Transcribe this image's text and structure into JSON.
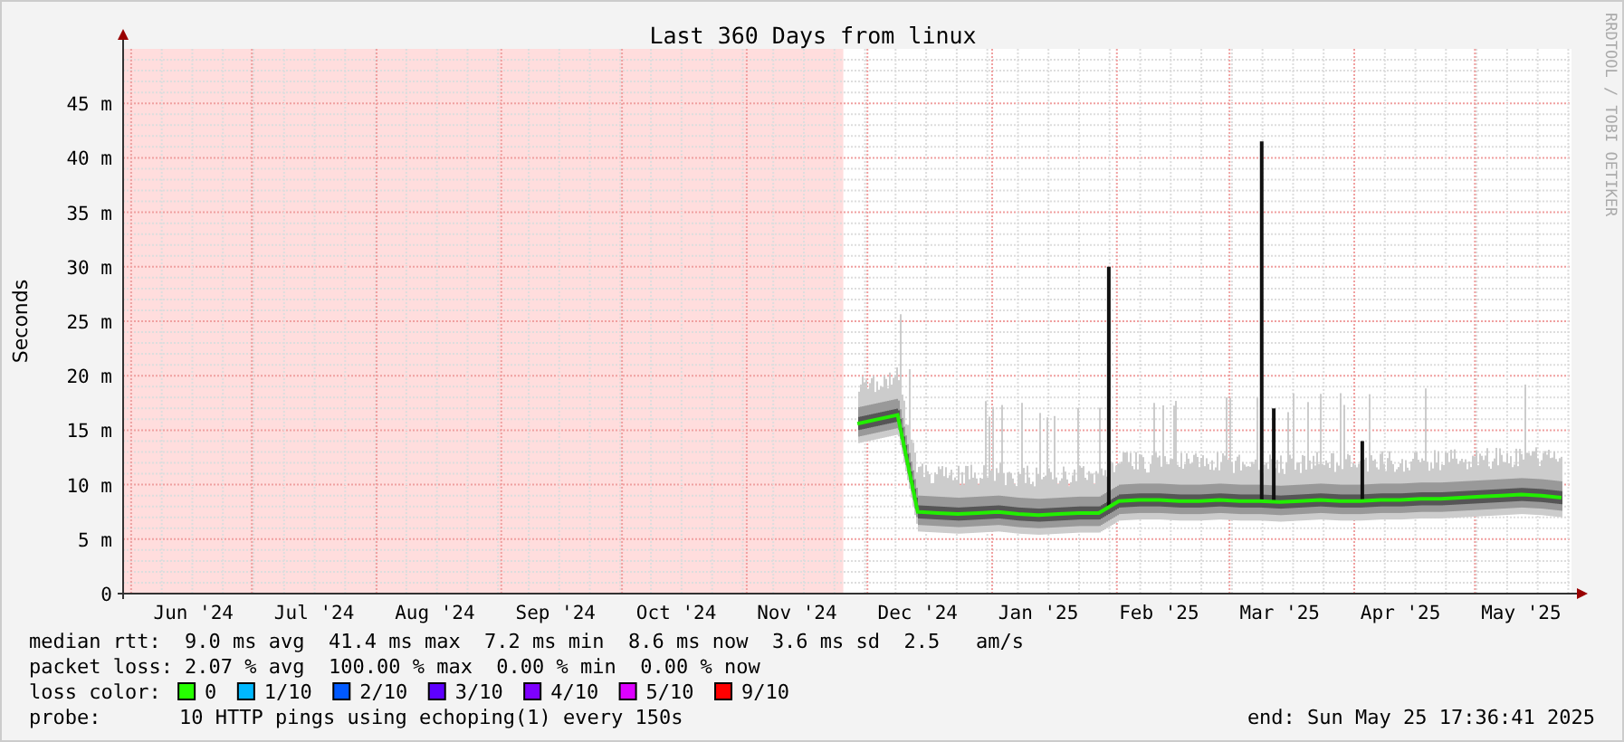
{
  "chart_data": {
    "type": "line",
    "title": "Last 360 Days from linux",
    "ylabel": "Seconds",
    "categories": [
      null,
      null,
      null,
      "Jun '24",
      null,
      null,
      null,
      null,
      null,
      "Jul '24",
      null,
      null,
      null,
      null,
      null,
      "Aug '24",
      null,
      null,
      null,
      null,
      null,
      "Sep '24",
      null,
      null,
      null,
      null,
      null,
      "Oct '24",
      null,
      null,
      null,
      null,
      null,
      "Nov '24",
      null,
      null,
      null,
      null,
      null,
      "Dec '24",
      null,
      null,
      null,
      null,
      null,
      "Jan '25",
      null,
      null,
      null,
      null,
      null,
      "Feb '25",
      null,
      null,
      null,
      null,
      null,
      "Mar '25",
      null,
      null,
      null,
      null,
      null,
      "Apr '25",
      null,
      null,
      null,
      null,
      null,
      "May '25",
      null,
      null
    ],
    "series": [
      {
        "color": "#22ee00",
        "values": [
          null,
          null,
          null,
          null,
          null,
          null,
          null,
          null,
          null,
          null,
          null,
          null,
          null,
          null,
          null,
          null,
          null,
          null,
          null,
          null,
          null,
          null,
          null,
          null,
          null,
          null,
          null,
          null,
          null,
          null,
          null,
          null,
          null,
          null,
          null,
          null,
          15.6,
          16,
          16.4,
          7.5,
          7.4,
          7.3,
          7.4,
          7.5,
          7.3,
          7.2,
          7.3,
          7.4,
          7.4,
          8.5,
          8.6,
          8.6,
          8.5,
          8.5,
          8.6,
          8.5,
          8.5,
          8.4,
          8.5,
          8.6,
          8.5,
          8.5,
          8.6,
          8.6,
          8.7,
          8.7,
          8.8,
          8.9,
          9.0,
          9.1,
          9.0,
          8.8
        ]
      }
    ],
    "ylim": [
      0,
      50
    ],
    "yticks": [
      {
        "value": 0,
        "label": "0"
      },
      {
        "value": 5,
        "label": "5 m"
      },
      {
        "value": 10,
        "label": "10 m"
      },
      {
        "value": 15,
        "label": "15 m"
      },
      {
        "value": 20,
        "label": "20 m"
      },
      {
        "value": 25,
        "label": "25 m"
      },
      {
        "value": 30,
        "label": "30 m"
      },
      {
        "value": 35,
        "label": "35 m"
      },
      {
        "value": 40,
        "label": "40 m"
      },
      {
        "value": 45,
        "label": "45 m"
      }
    ],
    "grid": true
  },
  "watermark_side": "RRDTOOL / TOBI OETIKER",
  "legend": {
    "median_rtt": {
      "label": "median rtt:",
      "values": [
        "9.0 ms avg",
        "41.4 ms max",
        "7.2 ms min",
        "8.6 ms now",
        "3.6 ms sd",
        "2.5   am/s"
      ]
    },
    "packet_loss": {
      "label": "packet loss:",
      "values": [
        "2.07 % avg",
        "100.00 % max",
        "0.00 % min",
        "0.00 % now"
      ]
    },
    "loss_color": {
      "label": "loss color:",
      "items": [
        {
          "label": "0",
          "color": "#26ff00"
        },
        {
          "label": "1/10",
          "color": "#00b8ff"
        },
        {
          "label": "2/10",
          "color": "#0059ff"
        },
        {
          "label": "3/10",
          "color": "#5e00ff"
        },
        {
          "label": "4/10",
          "color": "#7e00ff"
        },
        {
          "label": "5/10",
          "color": "#dd00ff"
        },
        {
          "label": "9/10",
          "color": "#ff0000"
        }
      ]
    },
    "probe": {
      "label": "probe:",
      "value": "10 HTTP pings using echoping(1) every 150s"
    },
    "end": "end: Sun May 25 17:36:41 2025"
  }
}
